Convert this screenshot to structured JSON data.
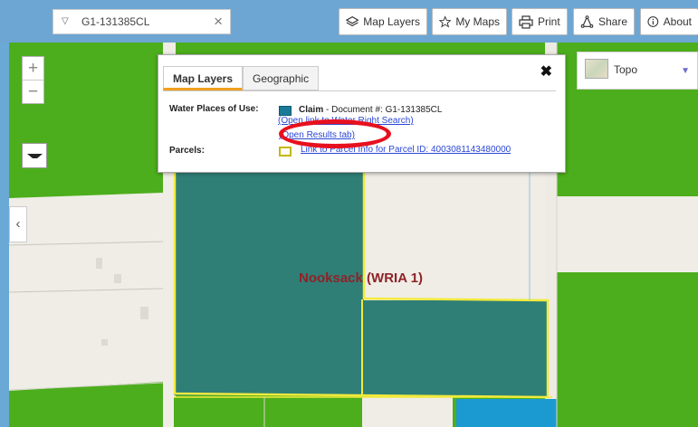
{
  "search": {
    "value": "G1-131385CL",
    "clear_glyph": "×"
  },
  "toolbar": {
    "map_layers": "Map Layers",
    "my_maps": "My Maps",
    "print": "Print",
    "share": "Share",
    "about": "About"
  },
  "basemap": {
    "selected": "Topo"
  },
  "map": {
    "region_label": "Nooksack (WRIA 1)"
  },
  "popup": {
    "tabs": [
      "Map Layers",
      "Geographic"
    ],
    "close_glyph": "✖",
    "water_label": "Water Places of Use:",
    "claim_bold": "Claim",
    "claim_text": " - Document #: G1-131385CL",
    "partial_link": "(Open link to Water Right Search)",
    "results_link": "(Open Results tab)",
    "parcels_label": "Parcels:",
    "parcel_link": "Link to Parcel Info for Parcel ID: 4003081143480000"
  },
  "colors": {
    "toolbar_bg": "#6ea6d3",
    "vegetation": "#4cae1c",
    "water_right_fill": "#2f7f77",
    "parcel_outline": "#f2ea3c",
    "annotation": "#e8101e",
    "region_label": "#8f2328"
  },
  "icons": {
    "map_layers": "layers-icon",
    "my_maps": "star-icon",
    "print": "printer-icon",
    "share": "share-icon",
    "about": "info-icon"
  }
}
